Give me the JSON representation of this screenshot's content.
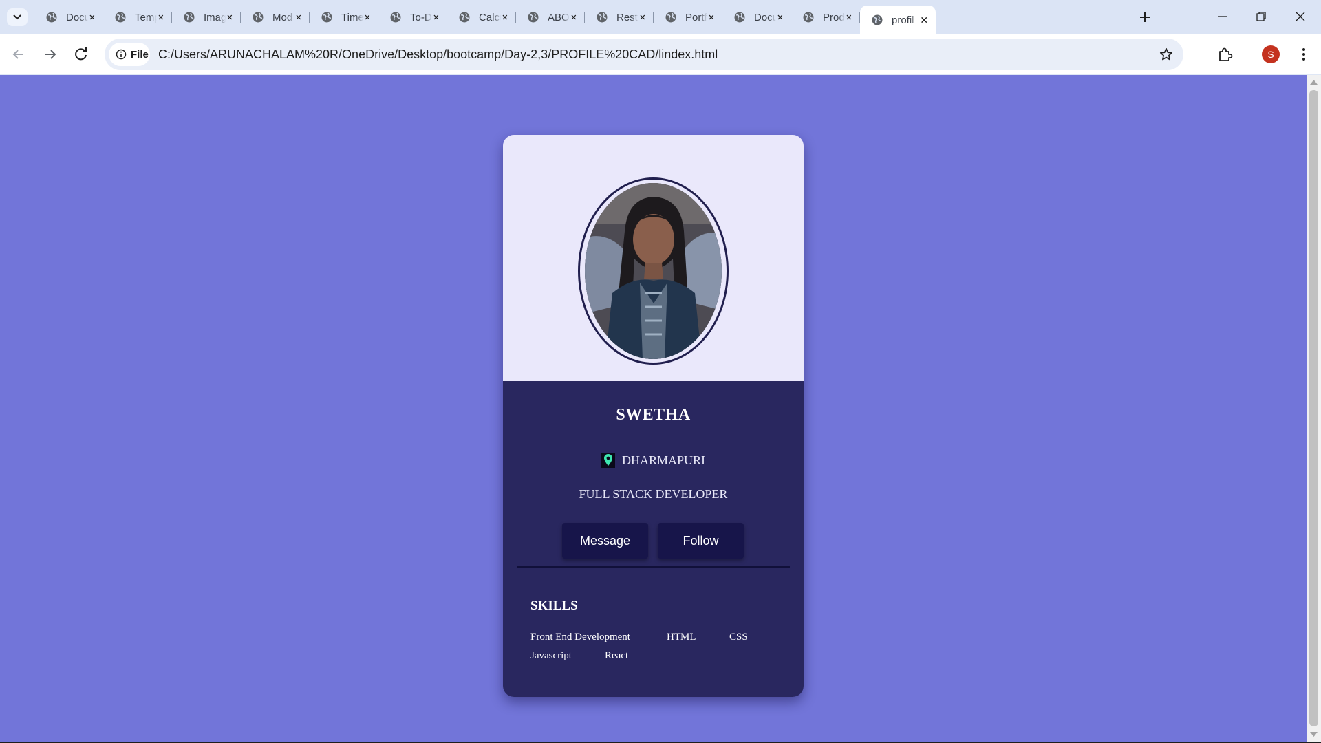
{
  "browser": {
    "tabs": [
      {
        "title": "Docu",
        "active": false
      },
      {
        "title": "Temp",
        "active": false
      },
      {
        "title": "Imag",
        "active": false
      },
      {
        "title": "Mod",
        "active": false
      },
      {
        "title": "Time",
        "active": false
      },
      {
        "title": "To-D",
        "active": false
      },
      {
        "title": "Calcu",
        "active": false
      },
      {
        "title": "ABOU",
        "active": false
      },
      {
        "title": "Resta",
        "active": false
      },
      {
        "title": "Portf",
        "active": false
      },
      {
        "title": "Docu",
        "active": false
      },
      {
        "title": "Prod",
        "active": false
      },
      {
        "title": "profil",
        "active": true
      }
    ],
    "omnibox": {
      "chip_label": "File",
      "url": "C:/Users/ARUNACHALAM%20R/OneDrive/Desktop/bootcamp/Day-2,3/PROFILE%20CAD/lindex.html"
    },
    "profile_initial": "S"
  },
  "colors": {
    "page_background": "#7275d9",
    "card_top": "#eae8fb",
    "card_bottom": "#29275f",
    "button": "#17154a",
    "pin_icon": "#3ee6b0",
    "avatar": "#c4321f"
  },
  "card": {
    "photo_icon": "profile-photo",
    "name": "SWETHA",
    "location": "DHARMAPURI",
    "location_icon": "location-pin-icon",
    "role": "FULL STACK DEVELOPER",
    "buttons": {
      "message": "Message",
      "follow": "Follow"
    },
    "skills": {
      "title": "SKILLS",
      "items": [
        "Front End Development",
        "HTML",
        "CSS",
        "Javascript",
        "React"
      ]
    }
  }
}
